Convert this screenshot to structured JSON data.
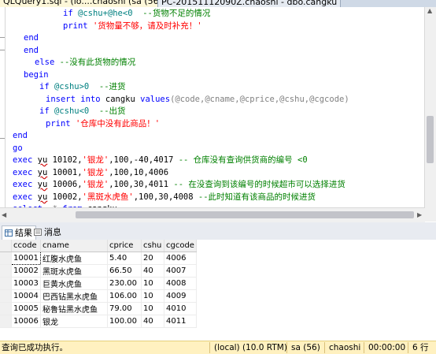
{
  "tabs": {
    "query_tab": "QLQuery1.sql - (lo....chaoshi (sa (56))*",
    "object_tab": "PC-20151112090Z.chaoshi - dbo.cangku"
  },
  "code": {
    "l1_kw": "if",
    "l1_cond": "@cshu+@he<0",
    "l1_cmt": "--货物不足的情况",
    "l2_kw": "print",
    "l2_str": "'货物量不够，请及时补充！'",
    "l3": "end",
    "l4": "end",
    "l5_kw": "else",
    "l5_cmt": "--没有此货物的情况",
    "l6": "begin",
    "l7_kw": "if",
    "l7_cond": "@cshu>0",
    "l7_cmt": "--进货",
    "l8_kw": "insert into",
    "l8_tbl": "cangku",
    "l8_kw2": "values",
    "l8_args": "(@code,@cname,@cprice,@cshu,@cgcode)",
    "l9_kw": "if",
    "l9_cond": "@cshu<0",
    "l9_cmt": "--出货",
    "l10_kw": "print",
    "l10_str": "'仓库中没有此商品！'",
    "l11": "end",
    "l12": "go",
    "l13_kw": "exec",
    "l13_fn": "yu",
    "l13_a": "10102,",
    "l13_str": "'银龙'",
    "l13_b": ",100,-40,4017",
    "l13_cmt": "-- 仓库没有查询供货商的编号 <0",
    "l14_kw": "exec",
    "l14_fn": "yu",
    "l14_a": "10001,",
    "l14_str": "'银龙'",
    "l14_b": ",100,10,4006",
    "l15_kw": "exec",
    "l15_fn": "yu",
    "l15_a": "10006,",
    "l15_str": "'银龙'",
    "l15_b": ",100,30,4011",
    "l15_cmt": "-- 在没查询到该编号的时候超市可以选择进货",
    "l16_kw": "exec",
    "l16_fn": "yu",
    "l16_a": "10002,",
    "l16_str": "'黑斑水虎鱼'",
    "l16_b": ",100,30,4008",
    "l16_cmt": "--此时知道有该商品的时候进货",
    "l17_kw": "select",
    "l17_star": "*",
    "l17_kw2": "from",
    "l17_tbl": "cangku"
  },
  "results_tabs": {
    "results": "结果",
    "messages": "消息"
  },
  "grid": {
    "columns": [
      "ccode",
      "cname",
      "cprice",
      "cshu",
      "cgcode"
    ],
    "rows": [
      [
        "10001",
        "红腹水虎鱼",
        "5.40",
        "20",
        "4006"
      ],
      [
        "10002",
        "黑斑水虎鱼",
        "66.50",
        "40",
        "4007"
      ],
      [
        "10003",
        "巨黄水虎鱼",
        "230.00",
        "10",
        "4008"
      ],
      [
        "10004",
        "巴西钻黑水虎鱼",
        "106.00",
        "10",
        "4009"
      ],
      [
        "10005",
        "秘鲁钻黑水虎鱼",
        "79.00",
        "10",
        "4010"
      ],
      [
        "10006",
        "银龙",
        "100.00",
        "40",
        "4011"
      ]
    ]
  },
  "status": {
    "message": "查询已成功执行。",
    "server": "(local) (10.0 RTM)",
    "user": "sa (56)",
    "db": "chaoshi",
    "time": "00:00:00",
    "rows": "6 行"
  },
  "colors": {
    "keyword": "#0000ff",
    "string": "#ff0000",
    "comment": "#008000",
    "status_bg": "#fff1c0"
  }
}
